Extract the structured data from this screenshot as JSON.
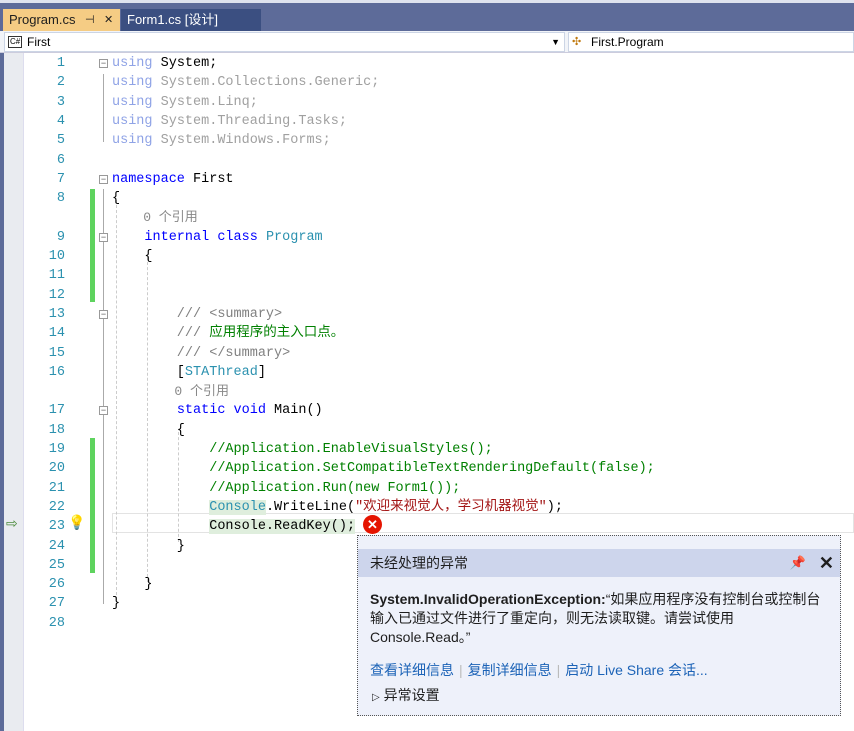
{
  "tabs": [
    {
      "label": "Program.cs",
      "active": true
    },
    {
      "label": "Form1.cs [设计]",
      "active": false
    }
  ],
  "tab_icons": {
    "pin": "pin-icon",
    "close": "close-icon"
  },
  "nav": {
    "project": "First",
    "project_badge": "C#",
    "member": "First.Program"
  },
  "colors": {
    "tab_active": "#f5cc84",
    "tab_bar": "#5d6b99",
    "change_bar": "#5ed35e",
    "line_number": "#2b91af"
  },
  "lines": [
    {
      "n": "1",
      "t": [
        [
          "using",
          "ukw"
        ],
        [
          " System;",
          "pl"
        ]
      ]
    },
    {
      "n": "2",
      "t": [
        [
          "using",
          "ukw"
        ],
        [
          " System.Collections.Generic;",
          "un"
        ]
      ]
    },
    {
      "n": "3",
      "t": [
        [
          "using",
          "ukw"
        ],
        [
          " System.Linq;",
          "un"
        ]
      ]
    },
    {
      "n": "4",
      "t": [
        [
          "using",
          "ukw"
        ],
        [
          " System.Threading.Tasks;",
          "un"
        ]
      ]
    },
    {
      "n": "5",
      "t": [
        [
          "using",
          "ukw"
        ],
        [
          " System.Windows.Forms;",
          "un"
        ]
      ]
    },
    {
      "n": "6",
      "t": []
    },
    {
      "n": "7",
      "t": [
        [
          "namespace",
          "kw"
        ],
        [
          " First",
          "pl"
        ]
      ]
    },
    {
      "n": "8",
      "t": [
        [
          "{",
          "pl"
        ]
      ]
    },
    {
      "lens": "0 个引用",
      "indent": 4
    },
    {
      "n": "9",
      "t": [
        [
          "    ",
          "pl"
        ],
        [
          "internal",
          "kw"
        ],
        [
          " ",
          "pl"
        ],
        [
          "class",
          "kw"
        ],
        [
          " ",
          "pl"
        ],
        [
          "Program",
          "ty"
        ]
      ]
    },
    {
      "n": "10",
      "t": [
        [
          "    {",
          "pl"
        ]
      ]
    },
    {
      "n": "11",
      "t": []
    },
    {
      "n": "12",
      "t": []
    },
    {
      "n": "13",
      "t": [
        [
          "        /// <summary>",
          "doc"
        ]
      ]
    },
    {
      "n": "14",
      "t": [
        [
          "        ///",
          "doc"
        ],
        [
          " 应用程序的主入口点。",
          "cm"
        ]
      ]
    },
    {
      "n": "15",
      "t": [
        [
          "        /// </summary>",
          "doc"
        ]
      ]
    },
    {
      "n": "16",
      "t": [
        [
          "        [",
          "pl"
        ],
        [
          "STAThread",
          "ty"
        ],
        [
          "]",
          "pl"
        ]
      ]
    },
    {
      "lens": "0 个引用",
      "indent": 8
    },
    {
      "n": "17",
      "t": [
        [
          "        ",
          "pl"
        ],
        [
          "static",
          "kw"
        ],
        [
          " ",
          "pl"
        ],
        [
          "void",
          "kw"
        ],
        [
          " Main()",
          "pl"
        ]
      ]
    },
    {
      "n": "18",
      "t": [
        [
          "        {",
          "pl"
        ]
      ]
    },
    {
      "n": "19",
      "t": [
        [
          "            //Application.EnableVisualStyles();",
          "cm"
        ]
      ]
    },
    {
      "n": "20",
      "t": [
        [
          "            //Application.SetCompatibleTextRenderingDefault(false);",
          "cm"
        ]
      ]
    },
    {
      "n": "21",
      "t": [
        [
          "            //Application.Run(new Form1());",
          "cm"
        ]
      ]
    },
    {
      "n": "22",
      "t": [
        [
          "            ",
          "pl"
        ],
        [
          "Console",
          "ty hl"
        ],
        [
          ".WriteLine(",
          "pl"
        ],
        [
          "\"欢迎来视觉人，学习机器视觉\"",
          "st"
        ],
        [
          ");",
          "pl"
        ]
      ]
    },
    {
      "n": "23",
      "t": [
        [
          "            ",
          "pl"
        ],
        [
          "Console.ReadKey();",
          "pl hl"
        ]
      ]
    },
    {
      "n": "24",
      "t": [
        [
          "        }",
          "pl"
        ]
      ]
    },
    {
      "n": "25",
      "t": []
    },
    {
      "n": "26",
      "t": [
        [
          "    }",
          "pl"
        ]
      ]
    },
    {
      "n": "27",
      "t": [
        [
          "}",
          "pl"
        ]
      ]
    },
    {
      "n": "28",
      "t": []
    }
  ],
  "popup": {
    "title": "未经处理的异常",
    "exception_type": "System.InvalidOperationException:",
    "message": "“如果应用程序没有控制台或控制台输入已通过文件进行了重定向，则无法读取键。请尝试使用 Console.Read。”",
    "links": [
      "查看详细信息",
      "复制详细信息",
      "启动 Live Share 会话..."
    ],
    "settings": "异常设置"
  }
}
